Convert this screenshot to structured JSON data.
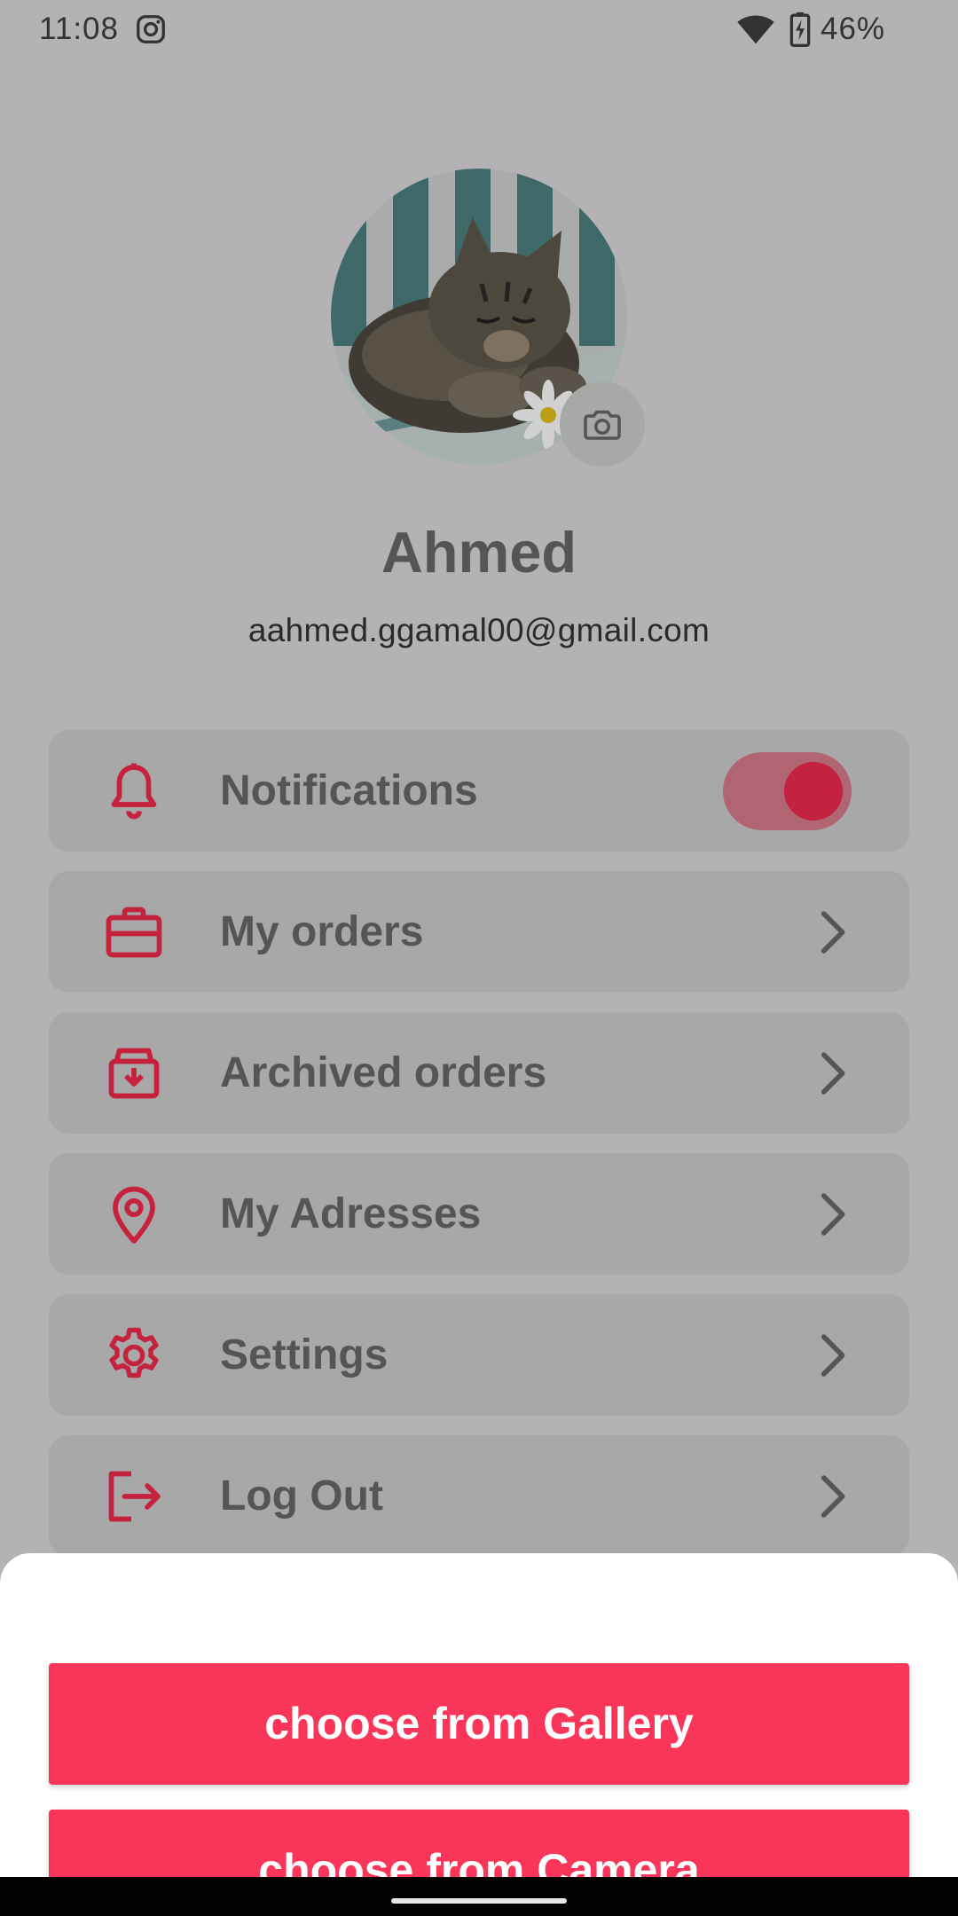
{
  "status_bar": {
    "time": "11:08",
    "battery_percent": "46%"
  },
  "profile": {
    "name": "Ahmed",
    "email": "aahmed.ggamal00@gmail.com"
  },
  "menu": {
    "items": [
      {
        "label": "Notifications",
        "icon": "bell-icon",
        "toggle_on": true
      },
      {
        "label": "My orders",
        "icon": "briefcase-icon"
      },
      {
        "label": "Archived orders",
        "icon": "archive-icon"
      },
      {
        "label": "My Adresses",
        "icon": "location-pin-icon"
      },
      {
        "label": "Settings",
        "icon": "gear-icon"
      },
      {
        "label": "Log Out",
        "icon": "logout-icon"
      }
    ]
  },
  "sheet": {
    "gallery_label": "choose from Gallery",
    "camera_label": "choose from Camera"
  },
  "colors": {
    "accent": "#f9365a",
    "icon_red": "#c4223f",
    "overlay_bg": "#b4b2b4",
    "card_bg": "#a9a8a9"
  }
}
